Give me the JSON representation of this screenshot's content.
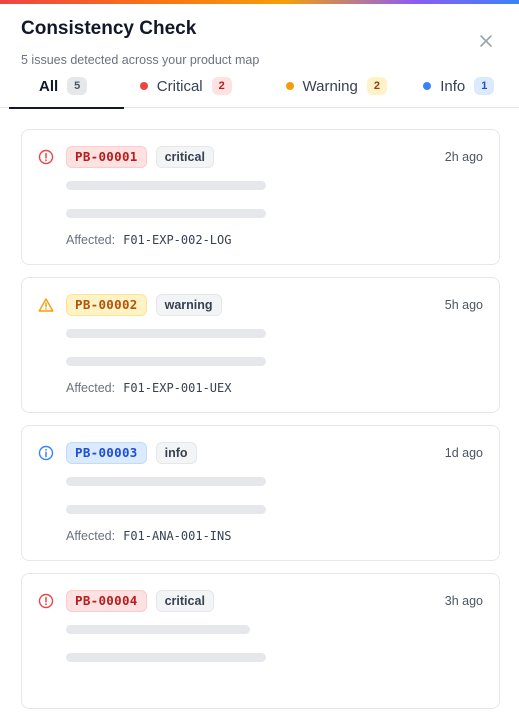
{
  "header": {
    "title": "Consistency Check",
    "subtitle": "5 issues detected across your product map"
  },
  "tabs": [
    {
      "label": "All",
      "count": "5"
    },
    {
      "label": "Critical",
      "count": "2"
    },
    {
      "label": "Warning",
      "count": "2"
    },
    {
      "label": "Info",
      "count": "1"
    }
  ],
  "issues": [
    {
      "id": "PB-00001",
      "severity": "critical",
      "time": "2h ago",
      "affected_label": "Affected:",
      "affected": "F01-EXP-002-LOG"
    },
    {
      "id": "PB-00002",
      "severity": "warning",
      "time": "5h ago",
      "affected_label": "Affected:",
      "affected": "F01-EXP-001-UEX"
    },
    {
      "id": "PB-00003",
      "severity": "info",
      "time": "1d ago",
      "affected_label": "Affected:",
      "affected": "F01-ANA-001-INS"
    },
    {
      "id": "PB-00004",
      "severity": "critical",
      "time": "3h ago",
      "affected_label": "",
      "affected": ""
    }
  ],
  "colors": {
    "critical": "#ef4444",
    "warning": "#f59e0b",
    "info": "#3b82f6"
  },
  "icons": {
    "close": "close-icon",
    "critical": "alert-circle-icon",
    "warning": "alert-triangle-icon",
    "info": "info-circle-icon"
  }
}
